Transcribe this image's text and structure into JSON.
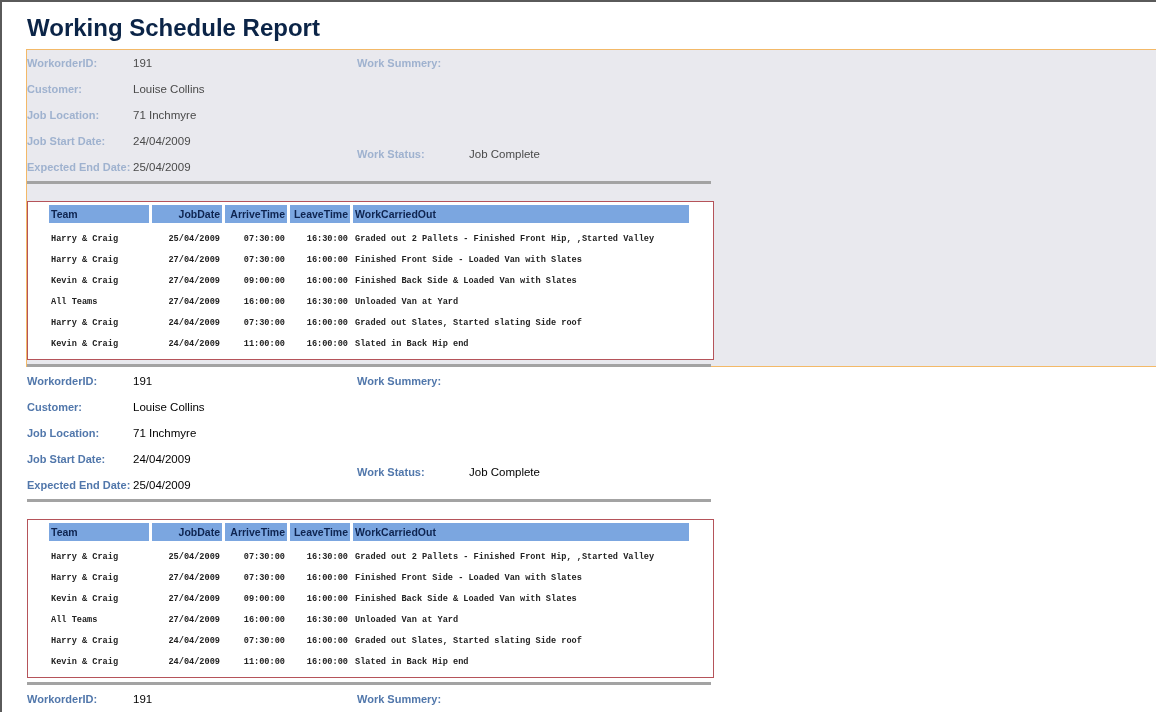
{
  "report": {
    "title": "Working Schedule Report"
  },
  "records": [
    {
      "selected": true,
      "left_fields": [
        {
          "label": "WorkorderID:",
          "value": "191"
        },
        {
          "label": "Customer:",
          "value": "Louise Collins"
        },
        {
          "label": "Job Location:",
          "value": "71 Inchmyre"
        },
        {
          "label": "Job Start Date:",
          "value": "24/04/2009"
        },
        {
          "label": "Expected End Date:",
          "value": "25/04/2009"
        }
      ],
      "right_fields": [
        {
          "label": "Work Summery:"
        },
        {
          "label": "Work Status:",
          "value": "Job Complete"
        }
      ],
      "table": {
        "columns": [
          "Team",
          "JobDate",
          "ArriveTime",
          "LeaveTime",
          "WorkCarriedOut"
        ],
        "rows": [
          [
            "Harry & Craig",
            "25/04/2009",
            "07:30:00",
            "16:30:00",
            "Graded out 2 Pallets - Finished Front Hip, ,Started Valley"
          ],
          [
            "Harry & Craig",
            "27/04/2009",
            "07:30:00",
            "16:00:00",
            "Finished Front Side - Loaded Van with Slates"
          ],
          [
            "Kevin & Craig",
            "27/04/2009",
            "09:00:00",
            "16:00:00",
            "Finished Back Side & Loaded Van with Slates"
          ],
          [
            "All Teams",
            "27/04/2009",
            "16:00:00",
            "16:30:00",
            "Unloaded Van at Yard"
          ],
          [
            "Harry & Craig",
            "24/04/2009",
            "07:30:00",
            "16:00:00",
            "Graded out Slates, Started slating Side roof"
          ],
          [
            "Kevin & Craig",
            "24/04/2009",
            "11:00:00",
            "16:00:00",
            "Slated in Back Hip end"
          ]
        ]
      }
    },
    {
      "selected": false,
      "left_fields": [
        {
          "label": "WorkorderID:",
          "value": "191"
        },
        {
          "label": "Customer:",
          "value": "Louise Collins"
        },
        {
          "label": "Job Location:",
          "value": "71 Inchmyre"
        },
        {
          "label": "Job Start Date:",
          "value": "24/04/2009"
        },
        {
          "label": "Expected End Date:",
          "value": "25/04/2009"
        }
      ],
      "right_fields": [
        {
          "label": "Work Summery:"
        },
        {
          "label": "Work Status:",
          "value": "Job Complete"
        }
      ],
      "table": {
        "columns": [
          "Team",
          "JobDate",
          "ArriveTime",
          "LeaveTime",
          "WorkCarriedOut"
        ],
        "rows": [
          [
            "Harry & Craig",
            "25/04/2009",
            "07:30:00",
            "16:30:00",
            "Graded out 2 Pallets - Finished Front Hip, ,Started Valley"
          ],
          [
            "Harry & Craig",
            "27/04/2009",
            "07:30:00",
            "16:00:00",
            "Finished Front Side - Loaded Van with Slates"
          ],
          [
            "Kevin & Craig",
            "27/04/2009",
            "09:00:00",
            "16:00:00",
            "Finished Back Side & Loaded Van with Slates"
          ],
          [
            "All Teams",
            "27/04/2009",
            "16:00:00",
            "16:30:00",
            "Unloaded Van at Yard"
          ],
          [
            "Harry & Craig",
            "24/04/2009",
            "07:30:00",
            "16:00:00",
            "Graded out Slates, Started slating Side roof"
          ],
          [
            "Kevin & Craig",
            "24/04/2009",
            "11:00:00",
            "16:00:00",
            "Slated in Back Hip end"
          ]
        ]
      }
    },
    {
      "selected": false,
      "left_fields": [
        {
          "label": "WorkorderID:",
          "value": "191"
        }
      ],
      "right_fields": [
        {
          "label": "Work Summery:"
        }
      ]
    }
  ]
}
